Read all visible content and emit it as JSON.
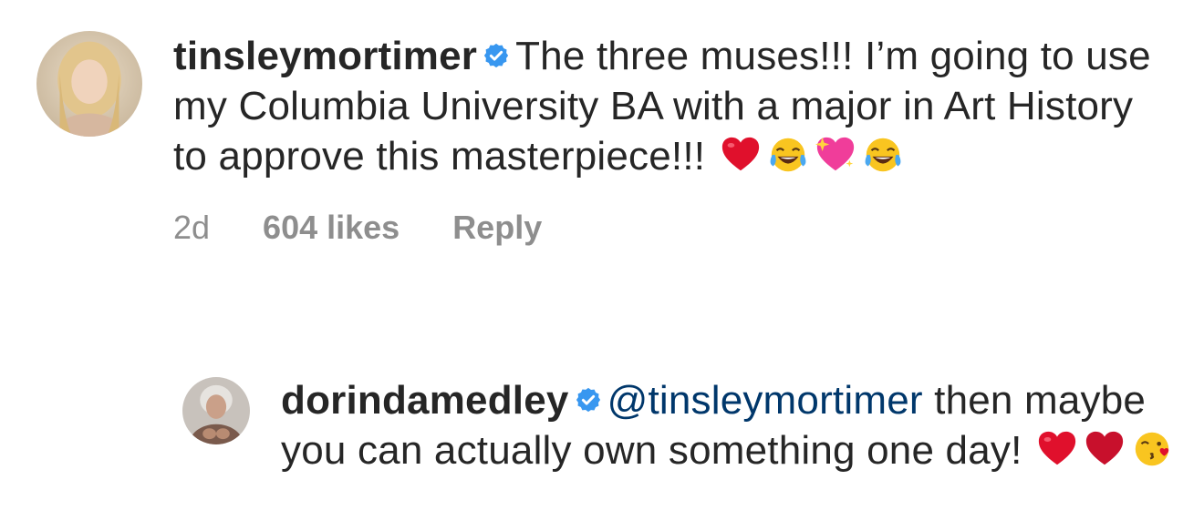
{
  "comments": [
    {
      "username": "tinsleymortimer",
      "verified": true,
      "text": "The three muses!!! I’m going to use my Columbia University BA with a major in Art History to approve this masterpiece!!!",
      "emojis": [
        "red-heart",
        "tears-of-joy",
        "sparkling-heart",
        "tears-of-joy"
      ],
      "time": "2d",
      "likes": "604 likes",
      "reply_label": "Reply"
    },
    {
      "username": "dorindamedley",
      "verified": true,
      "mention": "@tinsleymortimer",
      "text": "then maybe you can actually own something one day!",
      "emojis": [
        "red-heart",
        "red-heart",
        "face-blowing-kiss"
      ]
    }
  ],
  "icons": {
    "verified": "verified-badge-icon",
    "avatar_main": "avatar-tinsleymortimer",
    "avatar_reply": "avatar-dorindamedley"
  },
  "colors": {
    "text": "#262626",
    "meta": "#8e8e8e",
    "verified": "#3897f0",
    "mention": "#00376b",
    "heart": "#e0102c"
  }
}
